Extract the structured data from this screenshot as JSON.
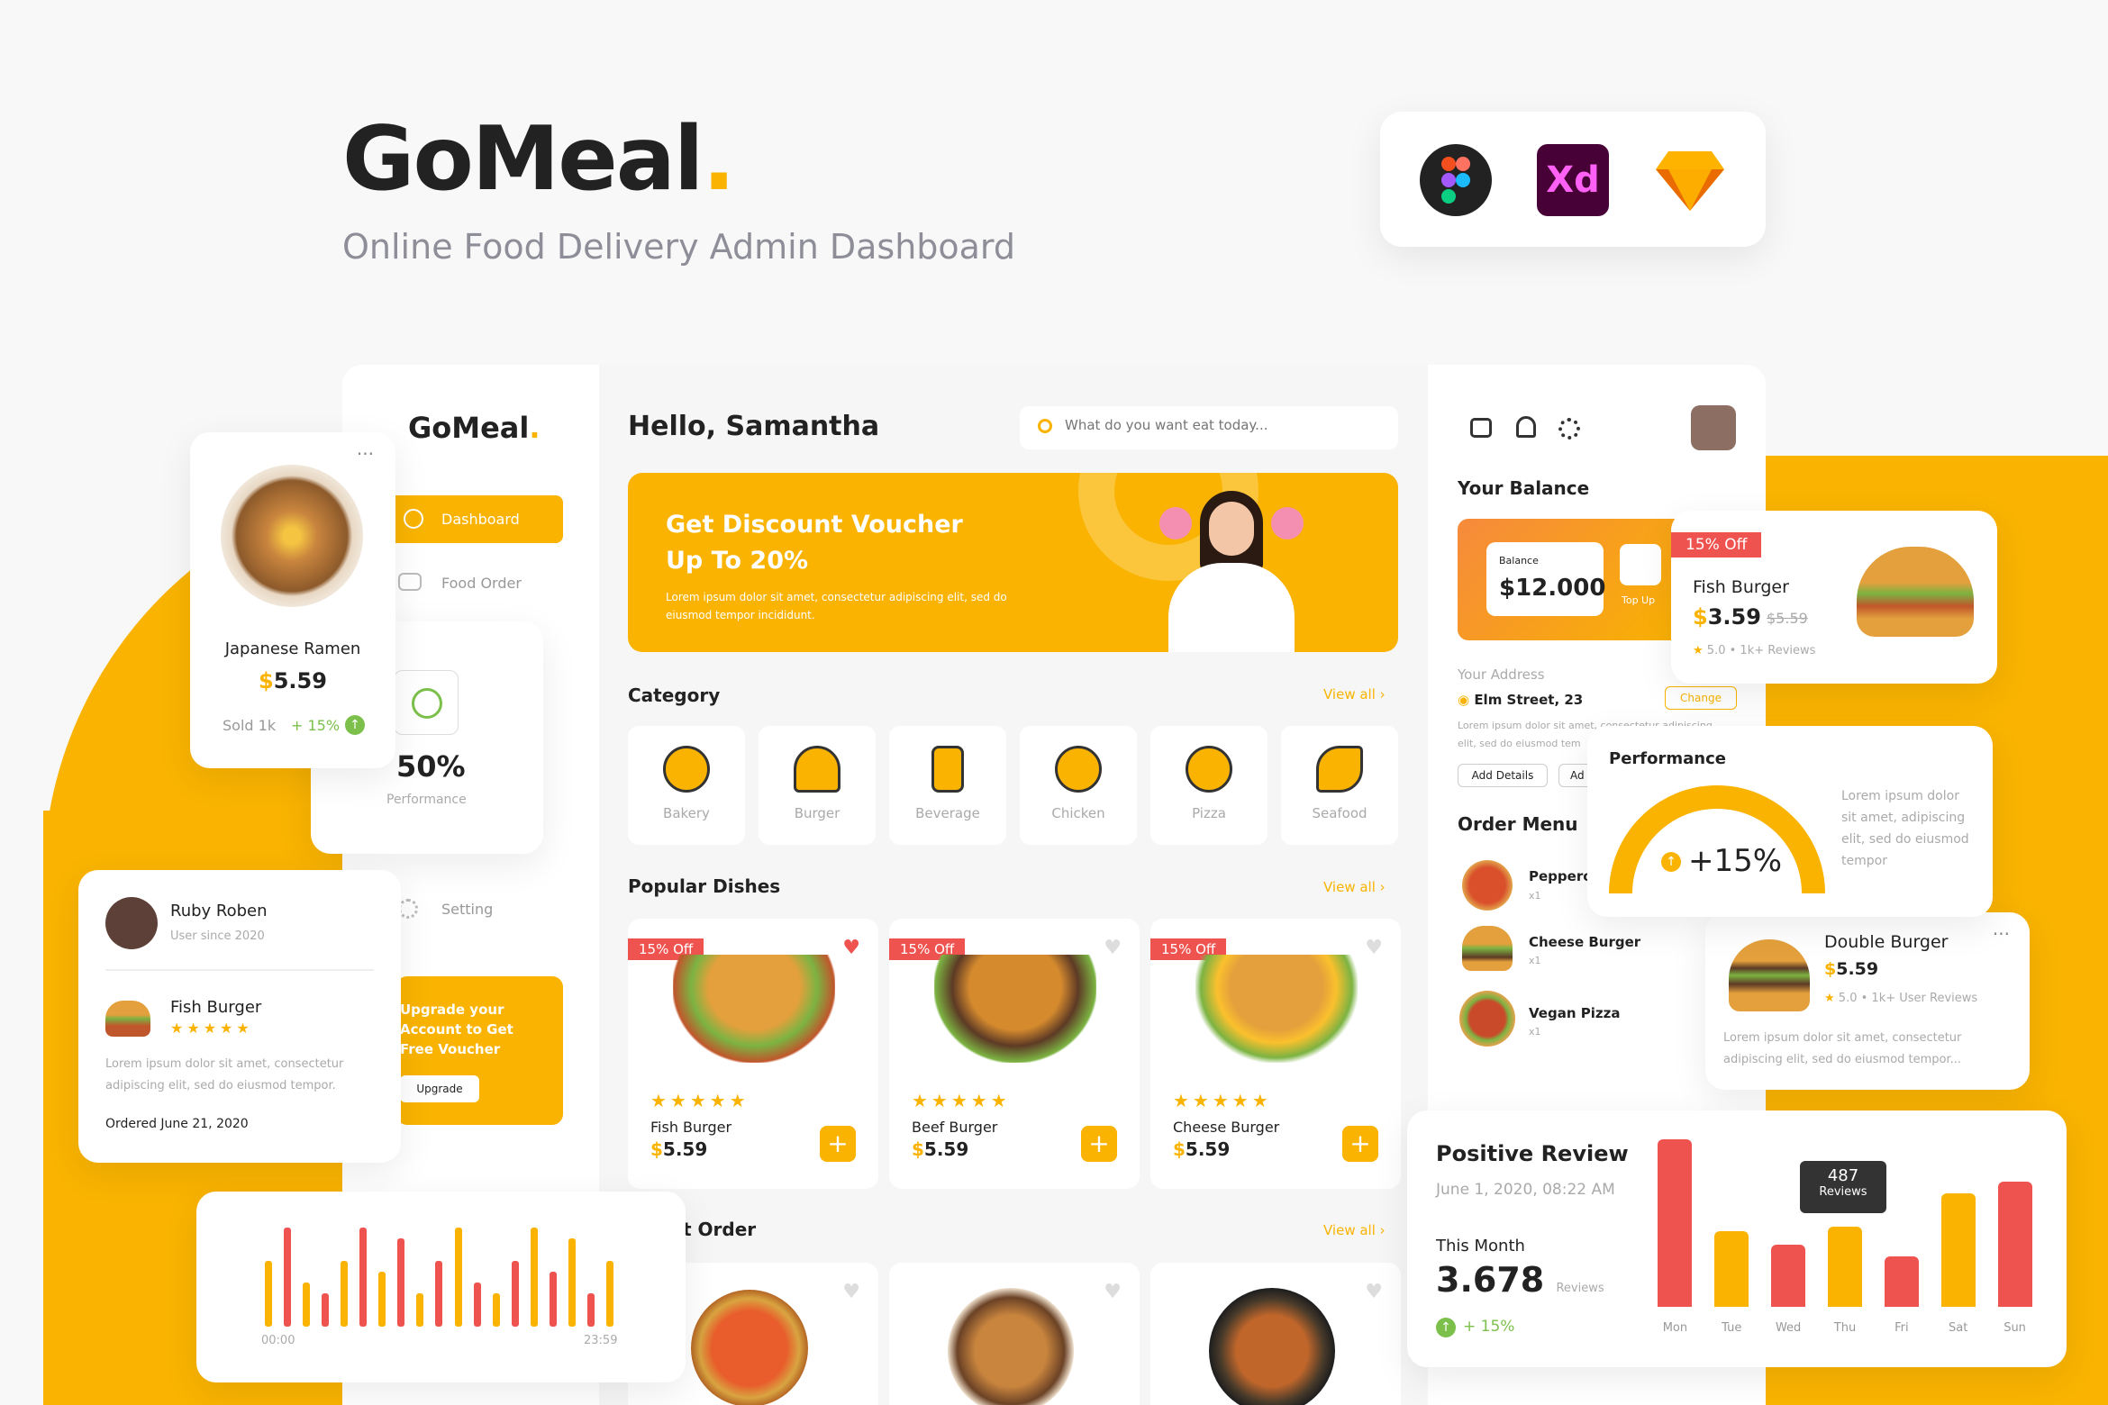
{
  "brand": {
    "name": "GoMeal",
    "dot": ".",
    "subtitle": "Online Food Delivery Admin Dashboard"
  },
  "tools": [
    {
      "icon": "figma-icon"
    },
    {
      "icon": "xd-icon",
      "label": "Xd"
    },
    {
      "icon": "sketch-icon"
    }
  ],
  "colors": {
    "accent": "#f9b300",
    "red": "#ef5350",
    "green": "#7cc04b",
    "text": "#222222"
  },
  "sidebar": {
    "logo": "GoMeal",
    "items": [
      {
        "label": "Dashboard"
      },
      {
        "label": "Food Order"
      },
      {
        "label": "Setting"
      }
    ],
    "performance": {
      "value": "50%",
      "label": "Performance"
    },
    "upgrade": {
      "text": "Upgrade your Account to Get Free Voucher",
      "button": "Upgrade"
    }
  },
  "header": {
    "greeting": "Hello, Samantha",
    "search_placeholder": "What do you want eat today..."
  },
  "banner": {
    "title_line1": "Get Discount Voucher",
    "title_line2": "Up To 20%",
    "body": "Lorem ipsum dolor sit amet, consectetur adipiscing elit, sed do eiusmod tempor incididunt."
  },
  "category": {
    "title": "Category",
    "view_all": "View all",
    "items": [
      "Bakery",
      "Burger",
      "Beverage",
      "Chicken",
      "Pizza",
      "Seafood"
    ]
  },
  "popular": {
    "title": "Popular Dishes",
    "view_all": "View all",
    "dishes": [
      {
        "badge": "15% Off",
        "name": "Fish Burger",
        "price": "5.59"
      },
      {
        "badge": "15% Off",
        "name": "Beef Burger",
        "price": "5.59"
      },
      {
        "badge": "15% Off",
        "name": "Cheese Burger",
        "price": "5.59"
      }
    ]
  },
  "recent": {
    "title": "t Order",
    "view_all": "View all"
  },
  "right_panel": {
    "balance_title": "Your Balance",
    "balance_label": "Balance",
    "balance": "$12.000",
    "top_up": "Top Up",
    "address_title": "Your Address",
    "address": "Elm Street, 23",
    "change": "Change",
    "address_body": "Lorem ipsum dolor sit amet, consectetur adipiscing elit, sed do eiusmod tem",
    "add_details": "Add Details",
    "add_note": "Ad",
    "order_menu": "Order Menu",
    "orders": [
      {
        "name": "Pepperoni",
        "qty": "x1"
      },
      {
        "name": "Cheese Burger",
        "qty": "x1"
      },
      {
        "name": "Vegan Pizza",
        "qty": "x1"
      }
    ]
  },
  "ramen_card": {
    "name": "Japanese Ramen",
    "price": "5.59",
    "sold": "Sold 1k",
    "growth": "+ 15%"
  },
  "review_card": {
    "user": "Ruby Roben",
    "since": "User since 2020",
    "dish": "Fish Burger",
    "body": "Lorem ipsum dolor sit amet, consectetur adipiscing elit, sed do eiusmod tempor.",
    "date": "Ordered June 21, 2020"
  },
  "fish_card": {
    "badge": "15% Off",
    "name": "Fish Burger",
    "price": "3.59",
    "old_price": "$5.59",
    "rating": "5.0",
    "reviews": "1k+ Reviews"
  },
  "performance_card": {
    "title": "Performance",
    "value": "+15%",
    "body": "Lorem ipsum dolor sit amet, adipiscing elit, sed do eiusmod tempor"
  },
  "double_card": {
    "name": "Double Burger",
    "price": "5.59",
    "rating": "5.0",
    "reviews": "1k+ User Reviews",
    "body": "Lorem ipsum dolor sit amet, consectetur adipiscing elit, sed do eiusmod tempor..."
  },
  "positive_review": {
    "title": "Positive Review",
    "date": "June 1, 2020, 08:22 AM",
    "month_label": "This Month",
    "count": "3.678",
    "count_unit": "Reviews",
    "growth": "+ 15%",
    "tooltip_value": "487",
    "tooltip_label": "Reviews"
  },
  "chart_data": [
    {
      "type": "bar",
      "categories": [
        "Mon",
        "Tue",
        "Wed",
        "Thu",
        "Fri",
        "Sat",
        "Sun"
      ],
      "values": [
        100,
        45,
        37,
        48,
        30,
        68,
        75
      ],
      "highlight": "Thu",
      "tooltip": "487 Reviews"
    },
    {
      "type": "bar",
      "x_start": "00:00",
      "x_end": "23:59",
      "values": [
        6,
        9,
        4,
        3,
        6,
        9,
        5,
        8,
        3,
        6,
        9,
        4,
        3,
        6,
        9,
        5,
        8,
        3,
        6
      ]
    }
  ],
  "timeline": {
    "start": "00:00",
    "end": "23:59"
  }
}
